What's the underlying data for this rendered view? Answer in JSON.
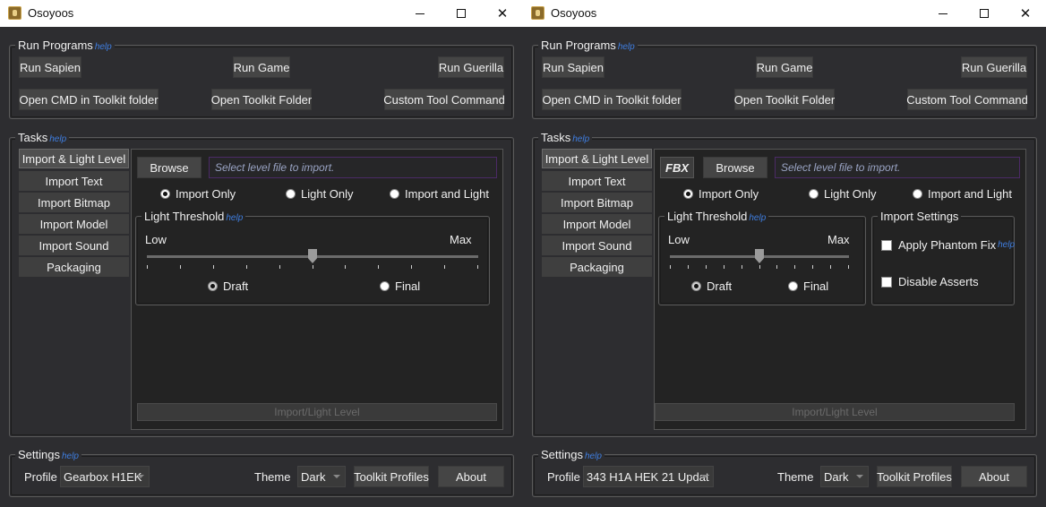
{
  "windows": [
    {
      "title": "Osoyoos",
      "run_programs": {
        "legend": "Run Programs",
        "help": "help",
        "buttons": [
          "Run Sapien",
          "Run Game",
          "Run Guerilla",
          "Open CMD in Toolkit folder",
          "Open Toolkit Folder",
          "Custom Tool Command"
        ]
      },
      "tasks": {
        "legend": "Tasks",
        "help": "help",
        "tabs": [
          "Import & Light Level",
          "Import Text",
          "Import Bitmap",
          "Import Model",
          "Import Sound",
          "Packaging"
        ],
        "browse_label": "Browse",
        "file_placeholder": "Select level file to import.",
        "radios": [
          "Import Only",
          "Light Only",
          "Import and Light"
        ],
        "threshold": {
          "legend": "Light Threshold",
          "help": "help",
          "low": "Low",
          "max": "Max",
          "value": 0.5,
          "quality": [
            "Draft",
            "Final"
          ]
        },
        "action_label": "Import/Light Level"
      },
      "settings": {
        "legend": "Settings",
        "help": "help",
        "profile_label": "Profile",
        "profile_value": "Gearbox H1EK",
        "theme_label": "Theme",
        "theme_value": "Dark",
        "toolkit_profiles": "Toolkit Profiles",
        "about": "About"
      }
    },
    {
      "title": "Osoyoos",
      "run_programs": {
        "legend": "Run Programs",
        "help": "help",
        "buttons": [
          "Run Sapien",
          "Run Game",
          "Run Guerilla",
          "Open CMD in Toolkit folder",
          "Open Toolkit Folder",
          "Custom Tool Command"
        ]
      },
      "tasks": {
        "legend": "Tasks",
        "help": "help",
        "tabs": [
          "Import & Light Level",
          "Import Text",
          "Import Bitmap",
          "Import Model",
          "Import Sound",
          "Packaging"
        ],
        "fbx_label": "FBX",
        "browse_label": "Browse",
        "file_placeholder": "Select level file to import.",
        "radios": [
          "Import Only",
          "Light Only",
          "Import and Light"
        ],
        "threshold": {
          "legend": "Light Threshold",
          "help": "help",
          "low": "Low",
          "max": "Max",
          "value": 0.5,
          "quality": [
            "Draft",
            "Final"
          ]
        },
        "import_settings": {
          "legend": "Import Settings",
          "apply_phantom_fix": "Apply Phantom Fix",
          "help": "help",
          "disable_asserts": "Disable Asserts"
        },
        "action_label": "Import/Light Level"
      },
      "settings": {
        "legend": "Settings",
        "help": "help",
        "profile_label": "Profile",
        "profile_value": "343 H1A HEK 21 Updat",
        "theme_label": "Theme",
        "theme_value": "Dark",
        "toolkit_profiles": "Toolkit Profiles",
        "about": "About"
      }
    }
  ]
}
